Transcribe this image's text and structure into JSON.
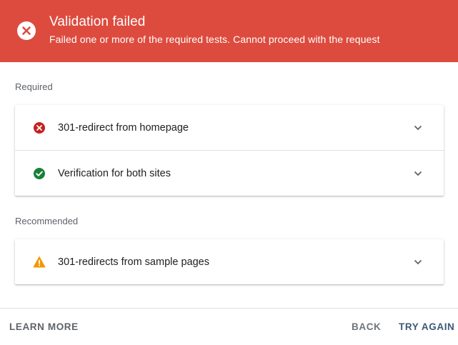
{
  "banner": {
    "title": "Validation failed",
    "subtitle": "Failed one or more of the required tests. Cannot proceed with the request",
    "color": "#dd4b3e",
    "icon": "error-circle-icon"
  },
  "sections": {
    "required": {
      "label": "Required",
      "items": [
        {
          "label": "301-redirect from homepage",
          "status": "error",
          "icon": "error-icon",
          "color": "#c5221f"
        },
        {
          "label": "Verification for both sites",
          "status": "pass",
          "icon": "check-circle-icon",
          "color": "#188038"
        }
      ]
    },
    "recommended": {
      "label": "Recommended",
      "items": [
        {
          "label": "301-redirects from sample pages",
          "status": "warning",
          "icon": "warning-icon",
          "color": "#f29900"
        }
      ]
    }
  },
  "footer": {
    "learn_more": "LEARN MORE",
    "back": "BACK",
    "try_again": "TRY AGAIN"
  }
}
